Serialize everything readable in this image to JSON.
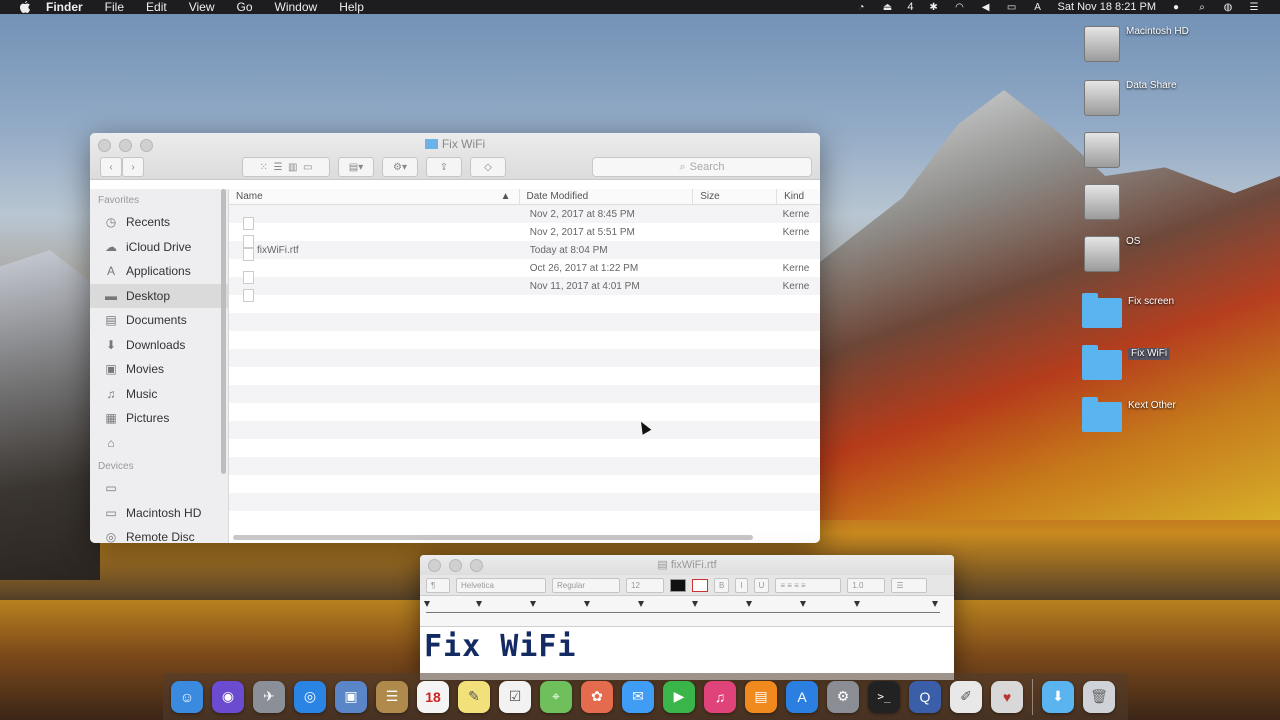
{
  "menubar": {
    "items": [
      "Finder",
      "File",
      "Edit",
      "View",
      "Go",
      "Window",
      "Help"
    ],
    "battery_label": "4",
    "clock": "Sat Nov 18  8:21 PM"
  },
  "desktop": {
    "items": [
      {
        "name": "Macintosh HD",
        "sub": "",
        "kind": "disk"
      },
      {
        "name": "Data Share",
        "sub": "",
        "kind": "disk"
      },
      {
        "name": "",
        "sub": "",
        "kind": "disk"
      },
      {
        "name": "",
        "sub": "",
        "kind": "disk"
      },
      {
        "name": "OS",
        "sub": "",
        "kind": "disk"
      },
      {
        "name": "Fix screen",
        "sub": "",
        "kind": "folder"
      },
      {
        "name": "Fix WiFi",
        "sub": "",
        "kind": "folder"
      },
      {
        "name": "Kext Other",
        "sub": "",
        "kind": "folder"
      }
    ]
  },
  "finder": {
    "title": "Fix WiFi",
    "search_placeholder": "Search",
    "sidebar": {
      "favorites_header": "Favorites",
      "favorites": [
        {
          "label": "Recents",
          "icon": "clock-icon"
        },
        {
          "label": "iCloud Drive",
          "icon": "cloud-icon"
        },
        {
          "label": "Applications",
          "icon": "applications-icon"
        },
        {
          "label": "Desktop",
          "icon": "desktop-icon"
        },
        {
          "label": "Documents",
          "icon": "documents-icon"
        },
        {
          "label": "Downloads",
          "icon": "downloads-icon"
        },
        {
          "label": "Movies",
          "icon": "movies-icon"
        },
        {
          "label": "Music",
          "icon": "music-icon"
        },
        {
          "label": "Pictures",
          "icon": "pictures-icon"
        },
        {
          "label": "",
          "icon": "home-icon"
        }
      ],
      "devices_header": "Devices",
      "devices": [
        {
          "label": "",
          "icon": "computer-icon"
        },
        {
          "label": "Macintosh HD",
          "icon": "disk-icon"
        },
        {
          "label": "Remote Disc",
          "icon": "remote-disc-icon"
        }
      ]
    },
    "columns": {
      "name": "Name",
      "date": "Date Modified",
      "size": "Size",
      "kind": "Kind"
    },
    "files": [
      {
        "name": "",
        "date": "Nov 2, 2017 at 8:45 PM",
        "size": "",
        "kind": "Kerne"
      },
      {
        "name": "",
        "date": "Nov 2, 2017 at 5:51 PM",
        "size": "",
        "kind": "Kerne"
      },
      {
        "name": "fixWiFi.rtf",
        "date": "Today at 8:04 PM",
        "size": "",
        "kind": ""
      },
      {
        "name": "",
        "date": "Oct 26, 2017 at 1:22 PM",
        "size": "",
        "kind": "Kerne"
      },
      {
        "name": "",
        "date": "Nov 11, 2017 at 4:01 PM",
        "size": "",
        "kind": "Kerne"
      }
    ]
  },
  "textedit": {
    "title": "fixWiFi.rtf",
    "toolbar": {
      "font": "Helvetica",
      "style": "Regular",
      "size": "12",
      "bold": "B",
      "italic": "I",
      "underline": "U"
    },
    "content": "Fix WiFi"
  },
  "dock": {
    "apps": [
      {
        "name": "finder",
        "glyph": "☺",
        "color": "#3a8be0"
      },
      {
        "name": "siri",
        "glyph": "◉",
        "color": "#6b4bd0"
      },
      {
        "name": "launchpad",
        "glyph": "✈",
        "color": "#8a8f98"
      },
      {
        "name": "safari",
        "glyph": "◎",
        "color": "#2a84e4"
      },
      {
        "name": "preview",
        "glyph": "▣",
        "color": "#5a86c8"
      },
      {
        "name": "contacts",
        "glyph": "☰",
        "color": "#b08a4c"
      },
      {
        "name": "calendar",
        "glyph": "18",
        "color": "#f4f4f4"
      },
      {
        "name": "notes",
        "glyph": "✎",
        "color": "#f2e07a"
      },
      {
        "name": "reminders",
        "glyph": "☑",
        "color": "#f2f2f2"
      },
      {
        "name": "maps",
        "glyph": "⌖",
        "color": "#6fbf5d"
      },
      {
        "name": "photos",
        "glyph": "✿",
        "color": "#e56b4f"
      },
      {
        "name": "messages",
        "glyph": "✉",
        "color": "#3f9df5"
      },
      {
        "name": "facetime",
        "glyph": "▶",
        "color": "#39b54a"
      },
      {
        "name": "itunes",
        "glyph": "♫",
        "color": "#e0427a"
      },
      {
        "name": "ibooks",
        "glyph": "▤",
        "color": "#f08a1f"
      },
      {
        "name": "app-store",
        "glyph": "A",
        "color": "#2b7fe0"
      },
      {
        "name": "system-preferences",
        "glyph": "⚙",
        "color": "#8a8d93"
      },
      {
        "name": "terminal",
        "glyph": ">_",
        "color": "#222222"
      },
      {
        "name": "quicktime",
        "glyph": "Q",
        "color": "#3a5ea8"
      },
      {
        "name": "textedit",
        "glyph": "✐",
        "color": "#e8e8e8"
      },
      {
        "name": "utility",
        "glyph": "♥",
        "color": "#d8d8d8"
      }
    ],
    "right": [
      {
        "name": "downloads-stack",
        "glyph": "⬇",
        "color": "#5ab4f0"
      },
      {
        "name": "trash",
        "glyph": "🗑",
        "color": "#cfd3d8"
      }
    ]
  }
}
